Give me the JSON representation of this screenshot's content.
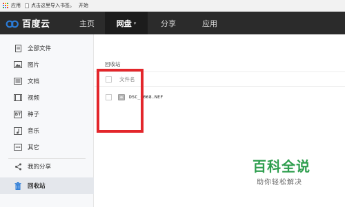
{
  "bookmarks": {
    "apps_label": "应用",
    "import_label": "点击这里导入书签。",
    "start_label": "开始",
    "grid_colors": [
      "#e94235",
      "#fbbc04",
      "#34a853",
      "#4285f4",
      "#e94235",
      "#fbbc04",
      "#34a853",
      "#4285f4",
      "#e94235"
    ]
  },
  "header": {
    "logo_text": "百度云",
    "tabs": [
      {
        "label": "主页"
      },
      {
        "label": "网盘"
      },
      {
        "label": "分享"
      },
      {
        "label": "应用"
      }
    ]
  },
  "sidebar": {
    "items": [
      {
        "label": "全部文件",
        "icon": "files-icon"
      },
      {
        "label": "图片",
        "icon": "image-icon"
      },
      {
        "label": "文档",
        "icon": "document-icon"
      },
      {
        "label": "视频",
        "icon": "video-icon"
      },
      {
        "label": "种子",
        "icon": "bt-icon",
        "icon_text": "BT"
      },
      {
        "label": "音乐",
        "icon": "music-icon"
      },
      {
        "label": "其它",
        "icon": "more-icon"
      },
      {
        "label": "我的分享",
        "icon": "share-icon"
      },
      {
        "label": "回收站",
        "icon": "trash-icon"
      }
    ]
  },
  "main": {
    "breadcrumb": "回收站",
    "table": {
      "header_label": "文件名",
      "rows": [
        {
          "name": "DSC_0068.NEF"
        }
      ]
    }
  },
  "watermark": {
    "title": "百科全说",
    "subtitle": "助你轻松解决"
  },
  "colors": {
    "accent": "#2b7bd6",
    "topbar": "#2b2b2b",
    "highlight": "#e3262b",
    "watermark": "#2e9e4e"
  }
}
